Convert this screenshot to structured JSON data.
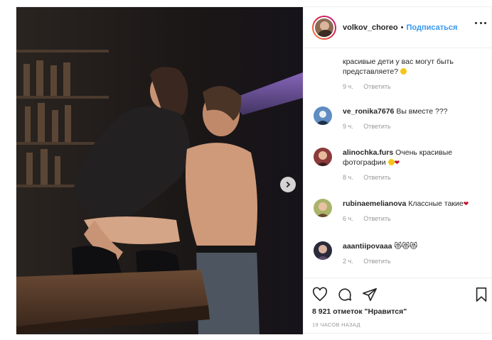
{
  "post": {
    "username": "volkov_choreo",
    "separator": "•",
    "follow_label": "Подписаться"
  },
  "comments": [
    {
      "text": "красивые дети у вас могут быть представляете?",
      "emoji": "smile",
      "time": "9 ч.",
      "reply": "Ответить"
    },
    {
      "user": "ve_ronika7676",
      "text": "Вы вместе ???",
      "time": "9 ч.",
      "reply": "Ответить"
    },
    {
      "user": "alinochka.furs",
      "text": "Очень красивые фотографии",
      "emoji": "smile-heart",
      "time": "8 ч.",
      "reply": "Ответить"
    },
    {
      "user": "rubinaemelianova",
      "text": "Классные такие",
      "emoji": "heart",
      "time": "6 ч.",
      "reply": "Ответить"
    },
    {
      "user": "aaantiipovaaa",
      "text": "😻😻😻",
      "time": "2 ч.",
      "reply": "Ответить"
    }
  ],
  "actions": {
    "likes": "8 921 отметок \"Нравится\"",
    "timestamp": "19 ЧАСОВ НАЗАД"
  },
  "icons": {
    "like": "heart-icon",
    "comment": "comment-icon",
    "share": "share-icon",
    "save": "bookmark-icon",
    "more": "more-options-icon",
    "next": "chevron-right-icon"
  },
  "colors": {
    "follow": "#3897f0",
    "heart": "#c0102a",
    "muted": "#999999"
  }
}
